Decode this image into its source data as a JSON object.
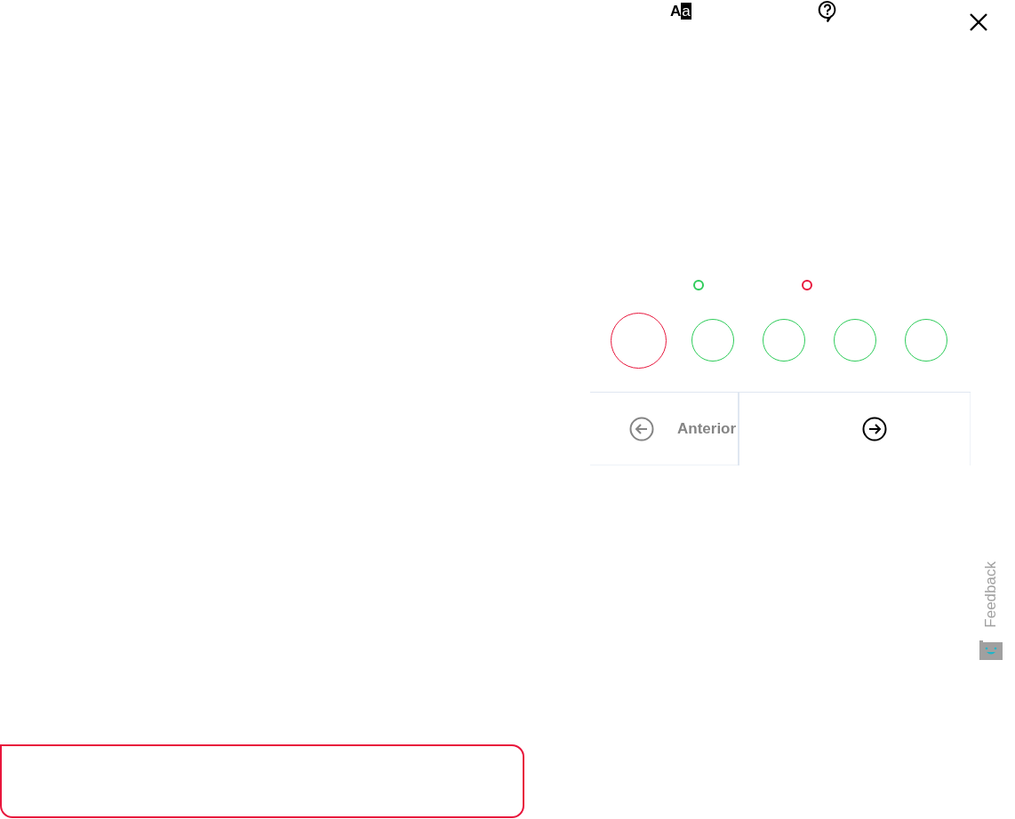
{
  "toolbar": {
    "font_icon_letters": [
      "A",
      "a"
    ]
  },
  "markers": [
    {
      "color": "#2ecc5a"
    },
    {
      "color": "#e8163c"
    }
  ],
  "steps": [
    {
      "color": "#e8163c",
      "selected": true
    },
    {
      "color": "#2ecc5a",
      "selected": false
    },
    {
      "color": "#2ecc5a",
      "selected": false
    },
    {
      "color": "#2ecc5a",
      "selected": false
    },
    {
      "color": "#2ecc5a",
      "selected": false
    }
  ],
  "navigation": {
    "previous": {
      "label": "Anterior",
      "disabled": true
    },
    "next": {
      "disabled": false
    }
  },
  "feedback": {
    "label": "Feedback"
  },
  "answer_box": {
    "color": "#e8163c"
  }
}
